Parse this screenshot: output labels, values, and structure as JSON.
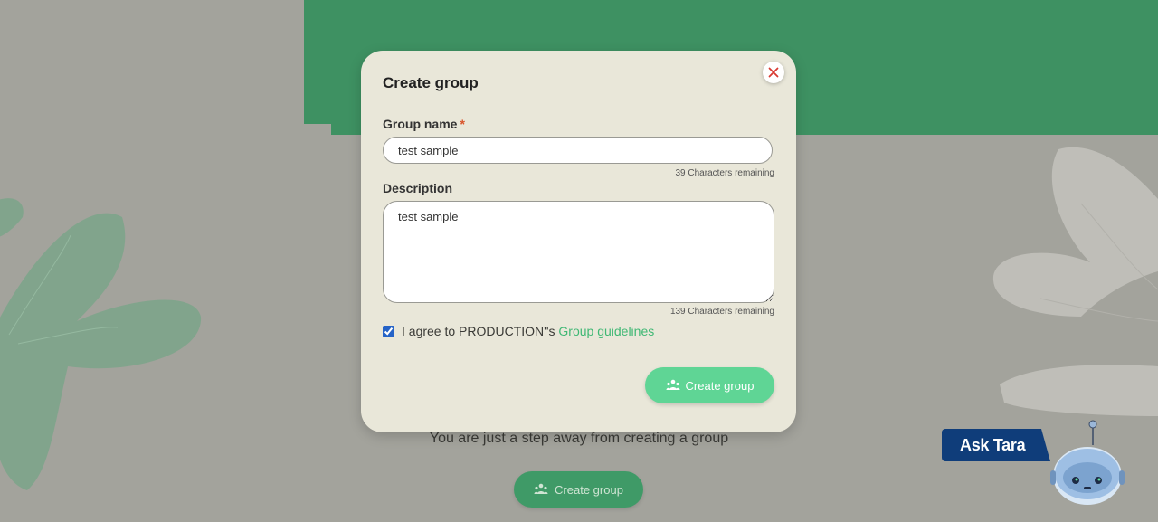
{
  "background": {
    "message": "You are just a step away from creating a group",
    "create_button_label": "Create group",
    "colors": {
      "page": "#a3a39c",
      "banner": "#3e9162",
      "leaf_green": "#7ba58a",
      "leaf_light": "#c2c1bb"
    }
  },
  "assistant": {
    "label": "Ask Tara",
    "pill_color": "#0f3d7a",
    "icon": "robot-icon"
  },
  "modal": {
    "title": "Create group",
    "close_icon": "close-icon",
    "group_name": {
      "label": "Group name",
      "required_marker": "*",
      "value": "test sample",
      "remaining": "39 Characters remaining"
    },
    "description": {
      "label": "Description",
      "value": "test sample",
      "remaining": "139 Characters remaining"
    },
    "agreement": {
      "checked": true,
      "text": "I agree to PRODUCTION''s",
      "link_text": "Group guidelines"
    },
    "submit": {
      "label": "Create group",
      "icon": "group-icon",
      "color": "#5fd595"
    }
  }
}
